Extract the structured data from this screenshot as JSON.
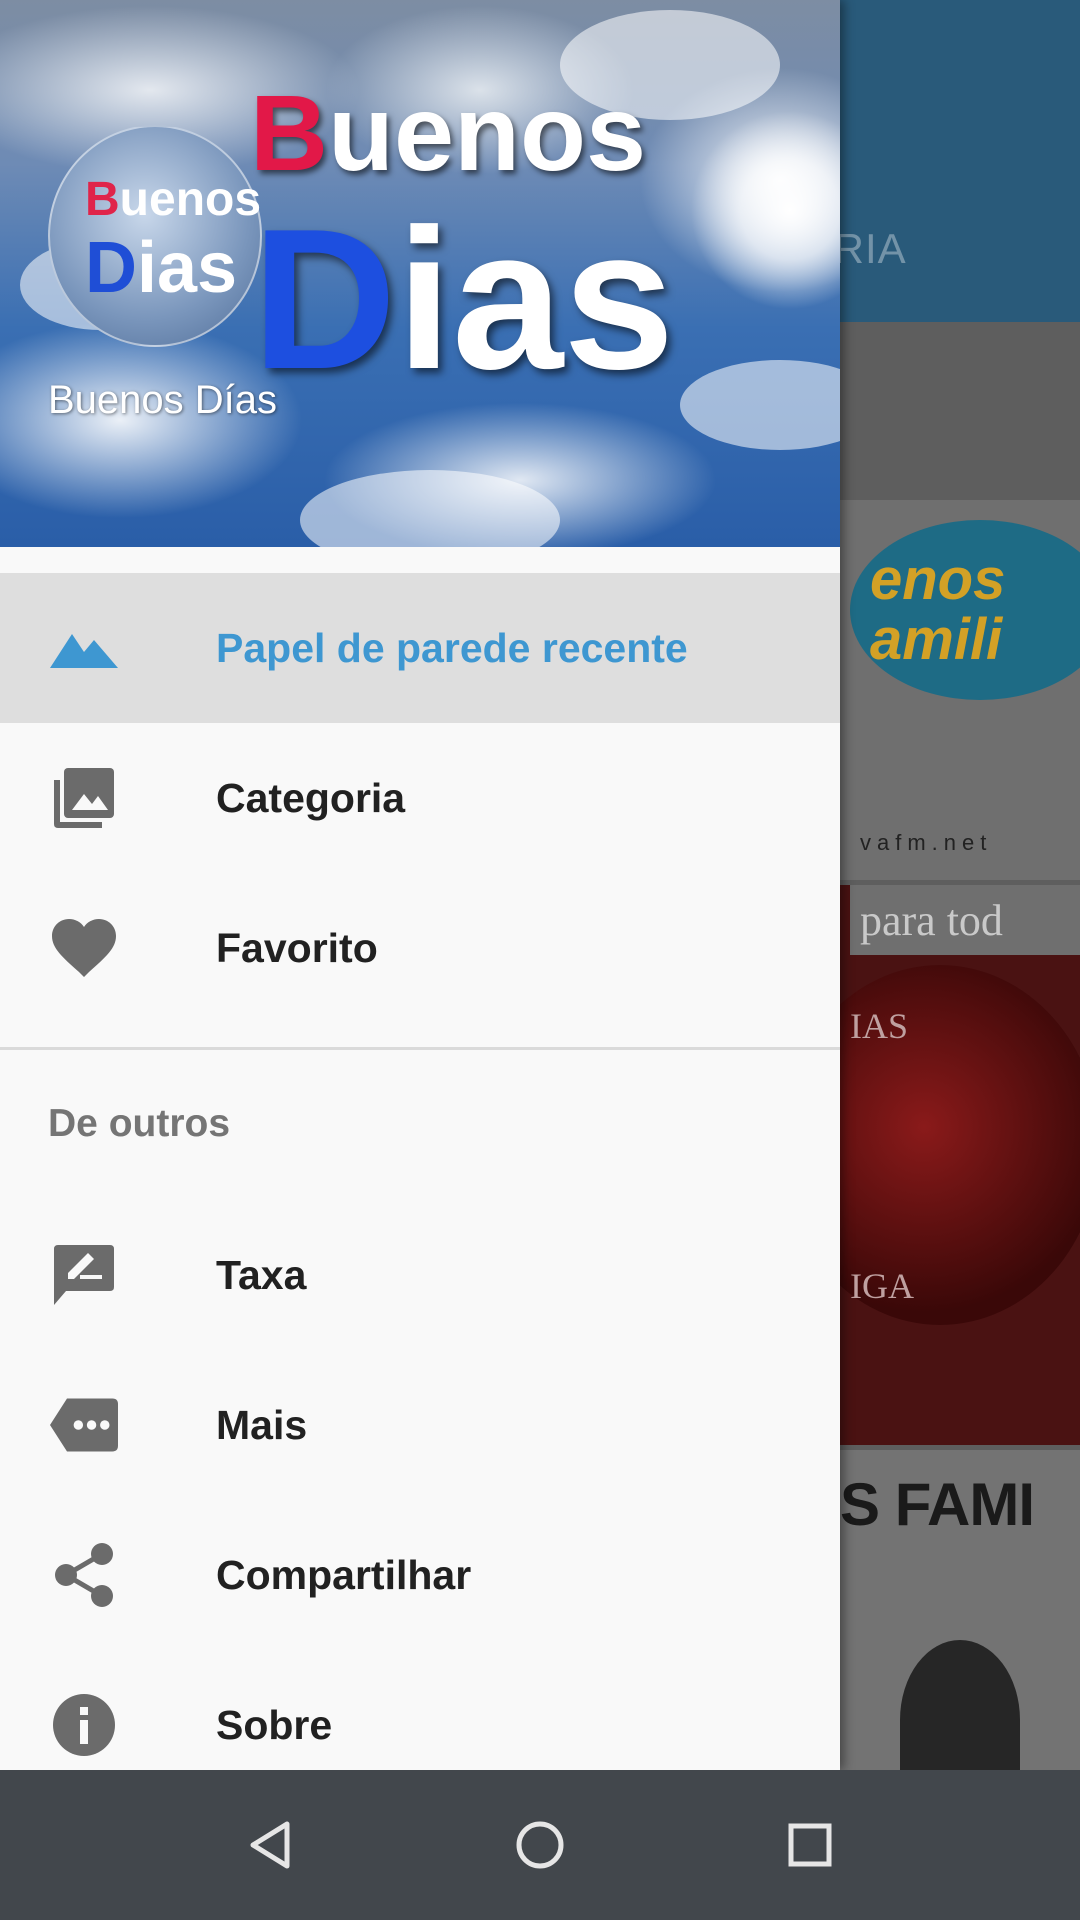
{
  "background": {
    "tab_label": "ORIA",
    "card1_logo_text": "enos\namili",
    "card1_url": "vafm.net",
    "card2_caption": "para tod",
    "card2_text_top": "IAS",
    "card2_text_bottom": "IGA",
    "card3_caption": "S FAMI"
  },
  "drawer": {
    "header": {
      "badge_line1_red": "B",
      "badge_line1_white": "uenos",
      "badge_line2_blue": "D",
      "badge_line2_white": "ias",
      "logo_line1_red": "B",
      "logo_line1_white": "uenos",
      "logo_line2_blue": "D",
      "logo_line2_white": "ias",
      "app_name": "Buenos Días"
    },
    "menu": [
      {
        "label": "Papel de parede recente",
        "icon": "landscape-icon",
        "selected": true
      },
      {
        "label": "Categoria",
        "icon": "photo-library-icon",
        "selected": false
      },
      {
        "label": "Favorito",
        "icon": "heart-icon",
        "selected": false
      }
    ],
    "section_title": "De outros",
    "other_menu": [
      {
        "label": "Taxa",
        "icon": "rate-review-icon"
      },
      {
        "label": "Mais",
        "icon": "more-apps-icon"
      },
      {
        "label": "Compartilhar",
        "icon": "share-icon"
      },
      {
        "label": "Sobre",
        "icon": "info-icon"
      }
    ]
  },
  "colors": {
    "selected_text": "#3e97d1",
    "icon_gray": "#6b6b6b",
    "toolbar": "#295a7a",
    "navbar": "#42474c"
  },
  "navbar": {
    "buttons": [
      "back-icon",
      "home-icon",
      "recents-icon"
    ]
  }
}
